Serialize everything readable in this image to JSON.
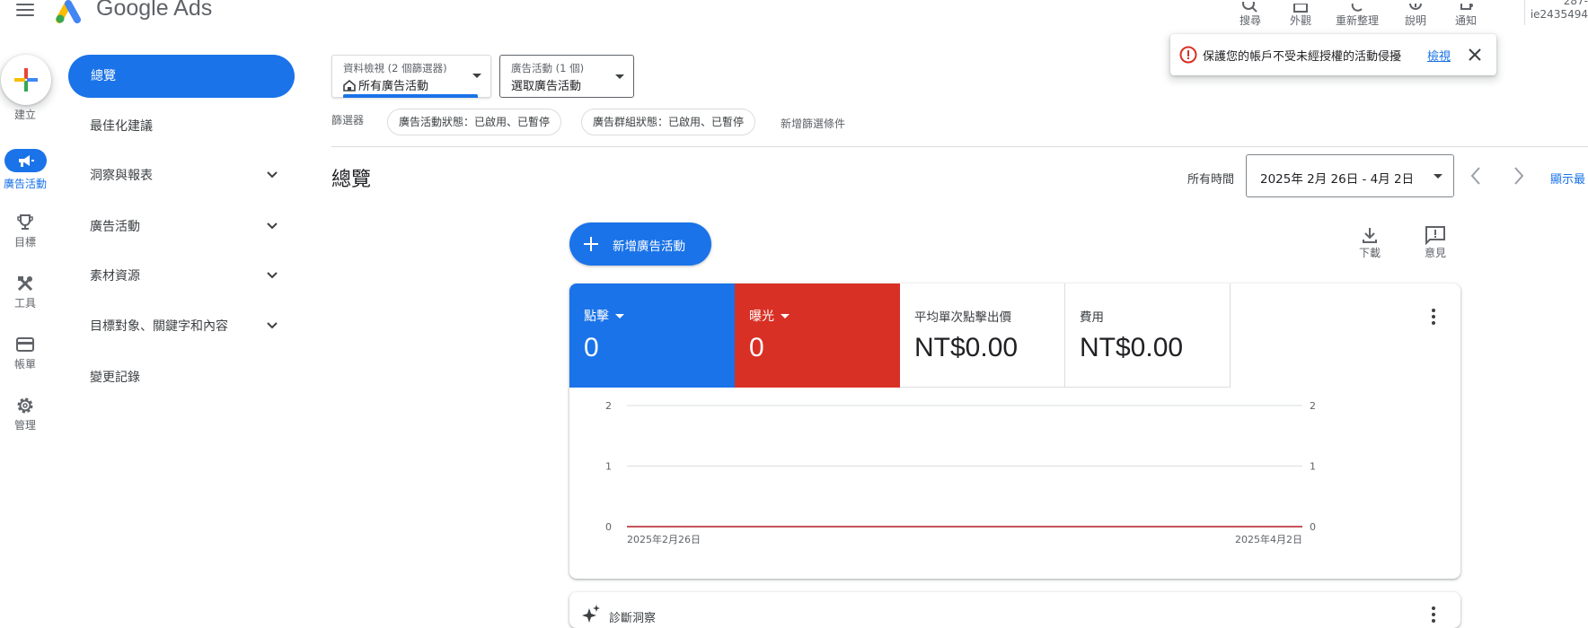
{
  "app": {
    "brand": "Google Ads"
  },
  "topbar": {
    "tools": [
      {
        "label": "搜尋",
        "icon": "search-icon"
      },
      {
        "label": "外觀",
        "icon": "appearance-icon"
      },
      {
        "label": "重新整理",
        "icon": "refresh-icon"
      },
      {
        "label": "說明",
        "icon": "help-icon"
      },
      {
        "label": "通知",
        "icon": "bell-icon"
      }
    ],
    "account_line1": "287-",
    "account_line2": "ie2435494"
  },
  "rail": {
    "create": "建立",
    "items": [
      {
        "label": "廣告活動",
        "icon": "megaphone-icon",
        "active": true
      },
      {
        "label": "目標",
        "icon": "trophy-icon"
      },
      {
        "label": "工具",
        "icon": "tools-icon"
      },
      {
        "label": "帳單",
        "icon": "credit-card-icon"
      },
      {
        "label": "管理",
        "icon": "gear-icon"
      }
    ]
  },
  "nav": {
    "active": "總覽",
    "items": [
      {
        "label": "最佳化建議"
      },
      {
        "label": "洞察與報表"
      },
      {
        "label": "廣告活動"
      },
      {
        "label": "素材資源"
      },
      {
        "label": "目標對象、關鍵字和內容"
      },
      {
        "label": "變更記錄"
      }
    ]
  },
  "filters": {
    "view_small": "資料檢視 (2 個篩選器)",
    "view_main": "所有廣告活動",
    "campaign_small": "廣告活動 (1 個)",
    "campaign_main": "選取廣告活動",
    "label": "篩選器",
    "chips": [
      "廣告活動狀態：已啟用、已暫停",
      "廣告群組狀態：已啟用、已暫停"
    ],
    "add": "新增篩選條件"
  },
  "overview": {
    "title": "總覽",
    "time_label": "所有時間",
    "date_range": "2025年 2月 26日 - 4月 2日",
    "show_link": "顯示最"
  },
  "actions": {
    "new_campaign": "新增廣告活動",
    "download": "下載",
    "feedback": "意見"
  },
  "metrics": [
    {
      "label": "點擊",
      "value": "0",
      "color": "#1a73e8"
    },
    {
      "label": "曝光",
      "value": "0",
      "color": "#d93025"
    },
    {
      "label": "平均單次點擊出價",
      "value": "NT$0.00"
    },
    {
      "label": "費用",
      "value": "NT$0.00"
    }
  ],
  "chart_data": {
    "type": "line",
    "x": [
      "2025年2月26日",
      "2025年4月2日"
    ],
    "series": [
      {
        "name": "點擊",
        "values": [
          0,
          0
        ],
        "color": "#1a73e8"
      },
      {
        "name": "曝光",
        "values": [
          0,
          0
        ],
        "color": "#d93025"
      }
    ],
    "y_ticks": [
      "2",
      "1",
      "0"
    ],
    "ylim": [
      0,
      2
    ],
    "grid": true
  },
  "diagnostics": {
    "title": "診斷洞察"
  },
  "notice": {
    "text": "保護您的帳戶不受未經授權的活動侵擾",
    "link": "檢視"
  }
}
